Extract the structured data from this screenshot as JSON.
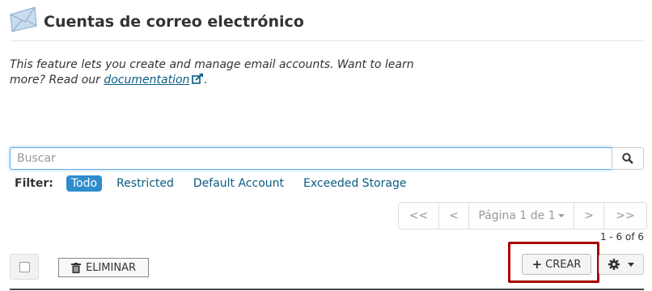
{
  "header": {
    "title": "Cuentas de correo electrónico",
    "icon": "envelope-icon"
  },
  "intro": {
    "text_before": "This feature lets you create and manage email accounts. Want to learn more? Read our ",
    "link_text": "documentation",
    "text_after": "."
  },
  "search": {
    "placeholder": "Buscar",
    "value": ""
  },
  "filter": {
    "label": "Filter:",
    "options": [
      "Todo",
      "Restricted",
      "Default Account",
      "Exceeded Storage"
    ],
    "active": "Todo"
  },
  "pagination": {
    "first": "<<",
    "prev": "<",
    "page_label": "Página 1 de 1",
    "next": ">",
    "last": ">>",
    "count": "1 - 6 of 6"
  },
  "actions": {
    "delete_label": "ELIMINAR",
    "create_label": "CREAR"
  },
  "colors": {
    "accent": "#2f8ccb",
    "link": "#0a5b82",
    "highlight": "#a80000"
  }
}
